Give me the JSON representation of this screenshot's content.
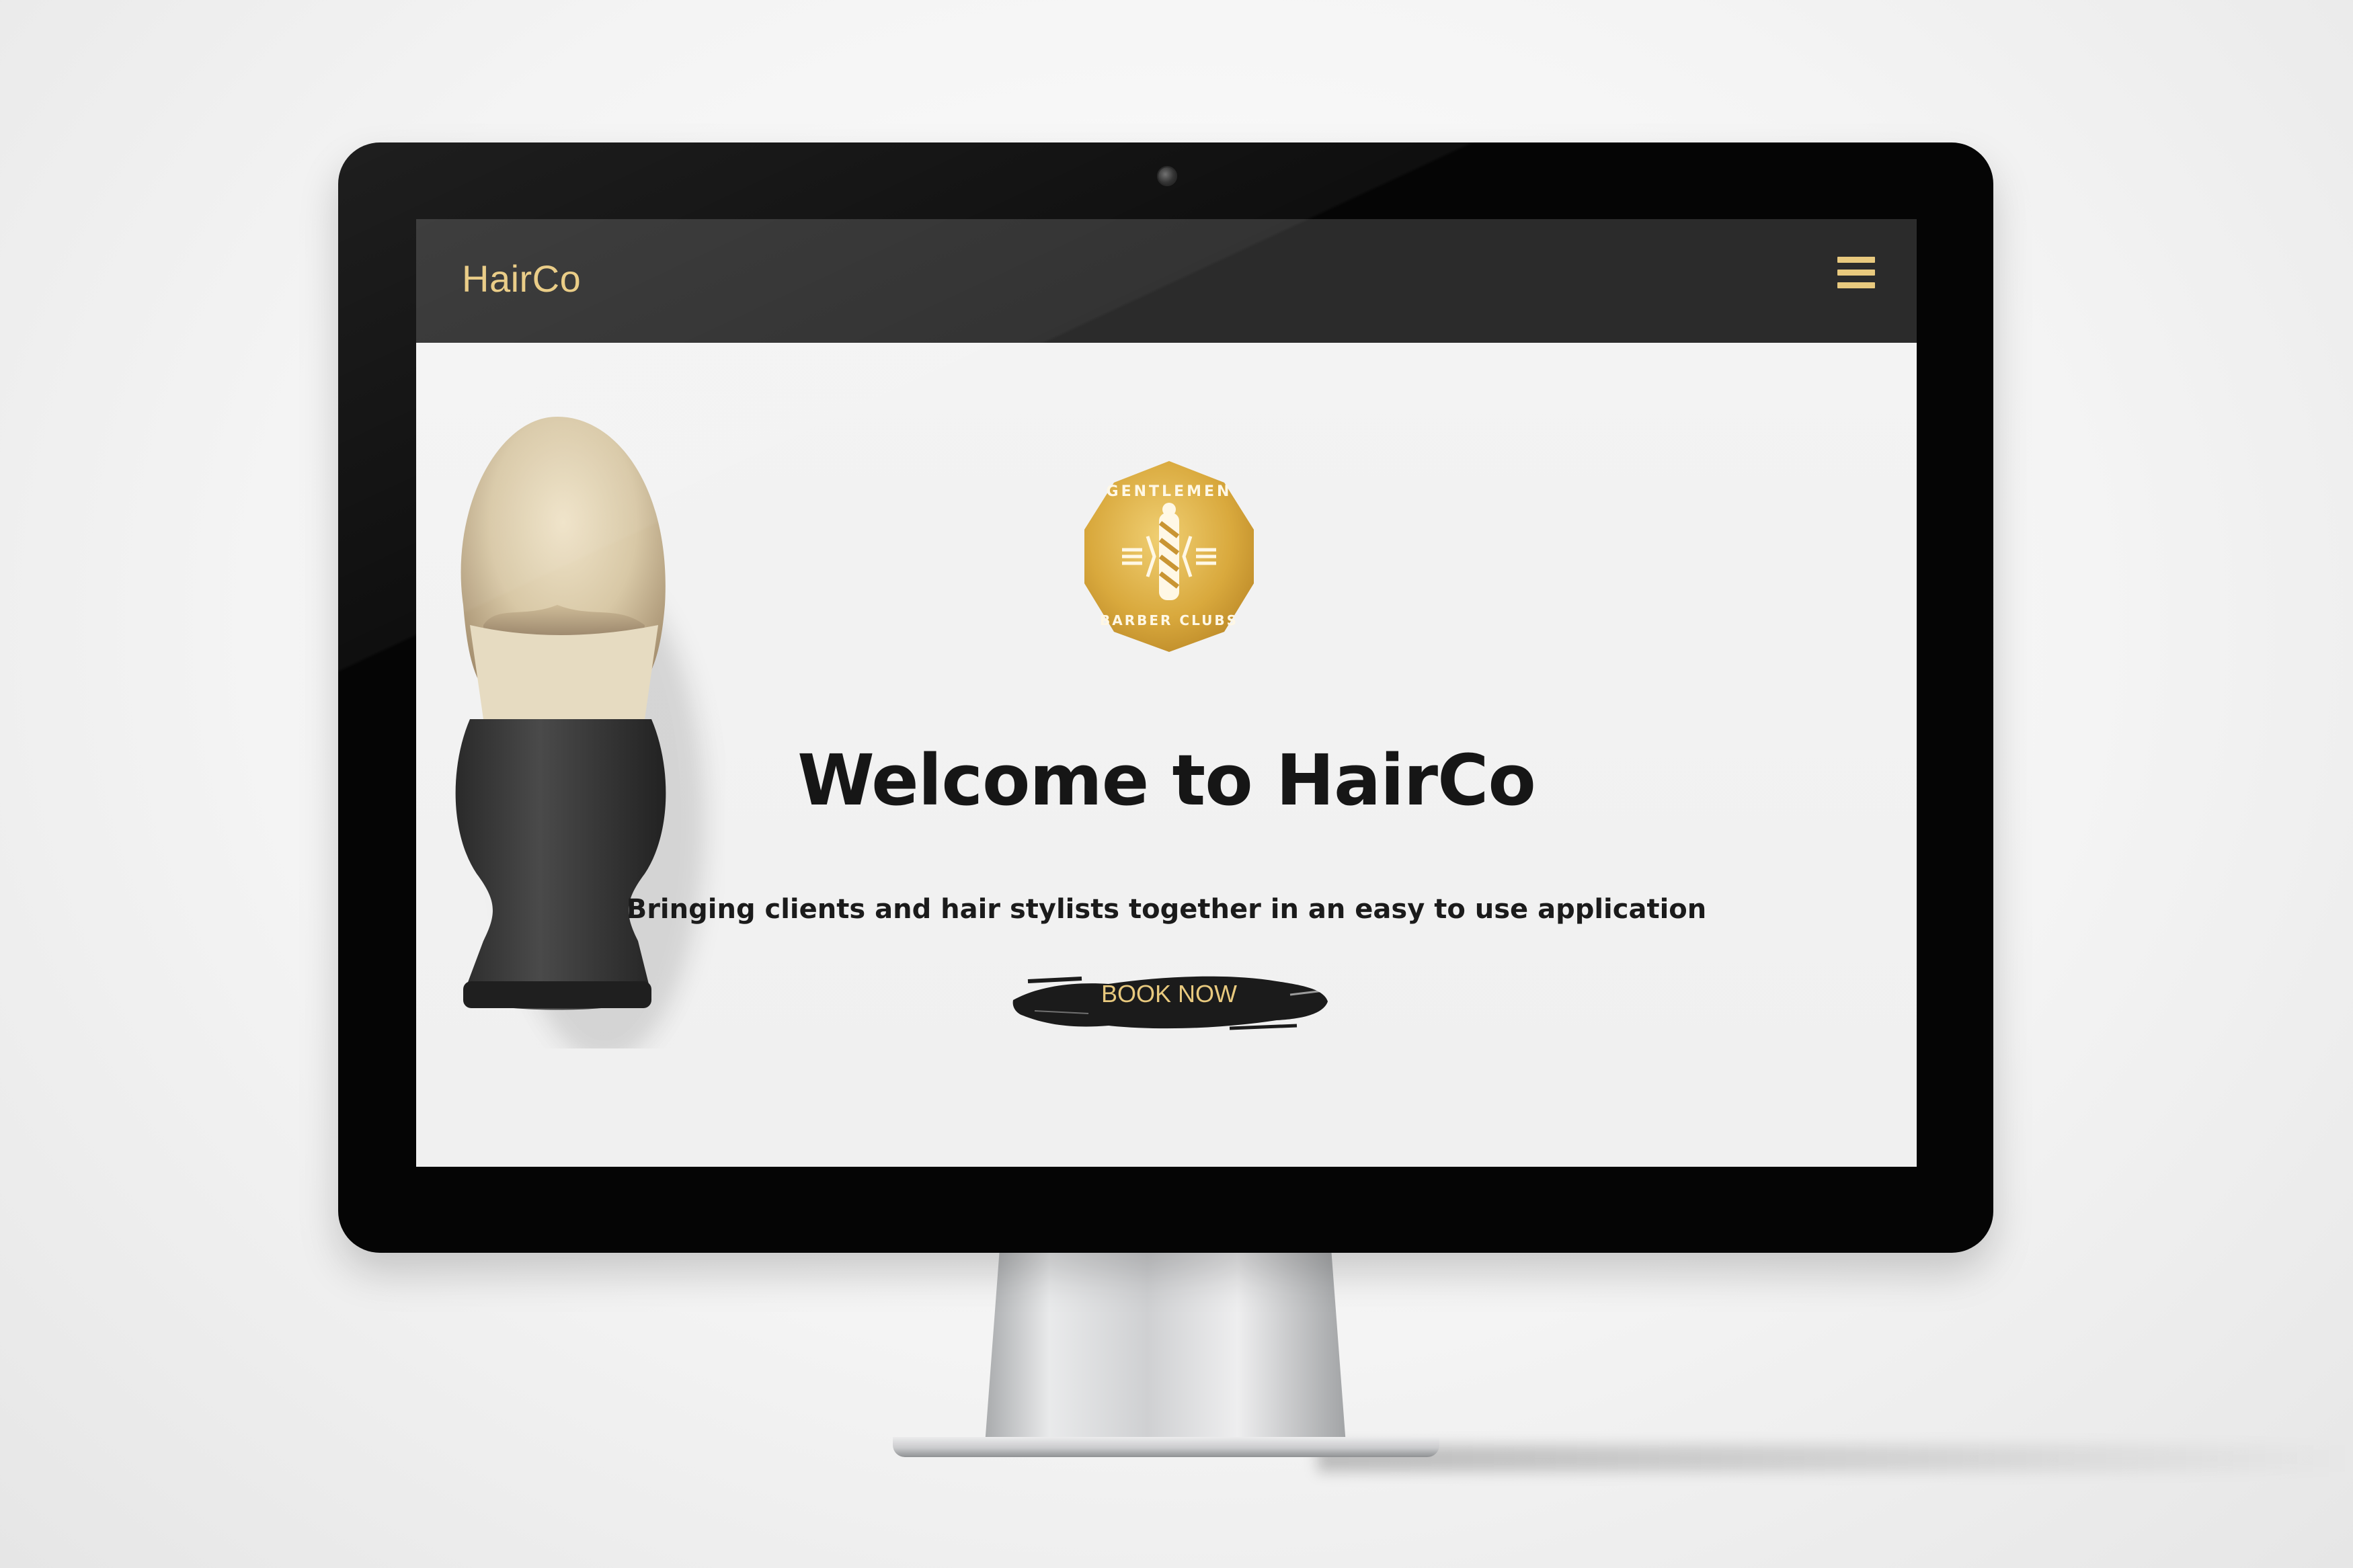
{
  "navbar": {
    "brand": "HairCo",
    "menu_icon": "hamburger-menu-icon"
  },
  "hero": {
    "logo_icon": "gentlemen-barber-clubs-logo",
    "logo_text_top": "GENTLEMEN",
    "logo_text_bottom": "BARBER CLUBS",
    "headline": "Welcome to HairCo",
    "subheadline": "Bringing clients and hair stylists together in an easy to use application",
    "cta_label": "BOOK NOW"
  },
  "colors": {
    "accent_gold": "#e8c97e",
    "navbar_bg": "#2b2b2b",
    "page_bg": "#f1f1f1",
    "text_dark": "#161616"
  }
}
